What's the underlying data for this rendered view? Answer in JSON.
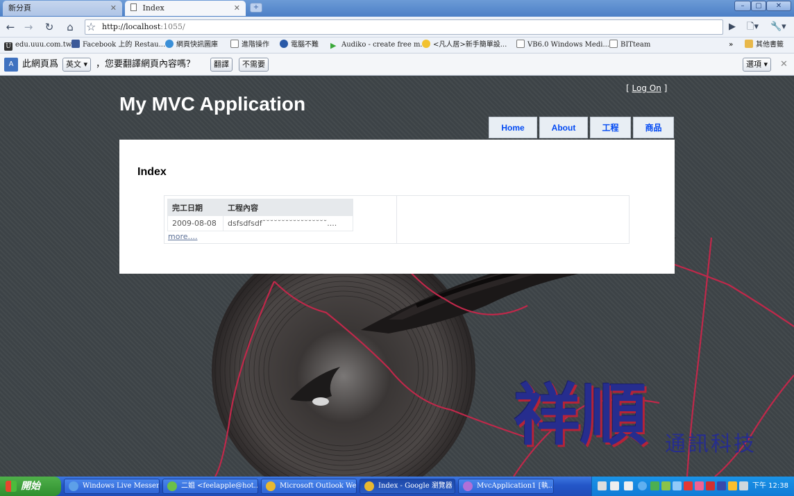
{
  "browser": {
    "tabs": [
      {
        "label": "新分頁",
        "active": false
      },
      {
        "label": "Index",
        "active": true
      }
    ],
    "window_controls": {
      "minimize": "–",
      "maximize": "▢",
      "close": "✕"
    },
    "address": {
      "host": "http://localhost",
      "rest": ":1055/"
    },
    "bookmarks": [
      "edu.uuu.com.tw",
      "Facebook 上的 Restau...",
      "網頁快訊圖庫",
      "進階操作",
      "電腦不難",
      "Audiko - create free m...",
      "<凡人居>新手簡單設...",
      "VB6.0 Windows Medi...",
      "BITteam"
    ],
    "bookmarks_more": "»",
    "other_bookmarks": "其他書籤",
    "translate_bar": {
      "prefix": "此網頁爲",
      "language": "英文 ▾",
      "question": "，您要翻譯網頁內容嗎？",
      "translate_btn": "翻譯",
      "no_btn": "不需要",
      "options_btn": "選項 ▾",
      "close": "✕"
    }
  },
  "site": {
    "logon": {
      "open": "[ ",
      "link": "Log On",
      "close": " ]"
    },
    "title": "My MVC Application",
    "menu": [
      "Home",
      "About",
      "工程",
      "商品"
    ],
    "heading": "Index",
    "table": {
      "headers": [
        "完工日期",
        "工程內容"
      ],
      "rows": [
        [
          "2009-08-08",
          "dsfsdfsdf˘˘˘˘˘˘˘˘˘˘˘˘˘˘˘˘˘...."
        ]
      ]
    },
    "more_link": "more....",
    "brand_main": "祥順",
    "brand_sub": "通訊科技"
  },
  "taskbar": {
    "start": "開始",
    "tasks": [
      "Windows Live Messen...",
      "二姐 <feelapple@hot...",
      "Microsoft Outlook We...",
      "Index - Google 瀏覽器",
      "MvcApplication1 [執..."
    ],
    "active_task": 3,
    "clock": "下午 12:38"
  },
  "colors": {
    "page_bg": "#3d4347",
    "menu_link": "#034af3",
    "brand": "#262d8e",
    "accent_red": "#c0284a"
  }
}
